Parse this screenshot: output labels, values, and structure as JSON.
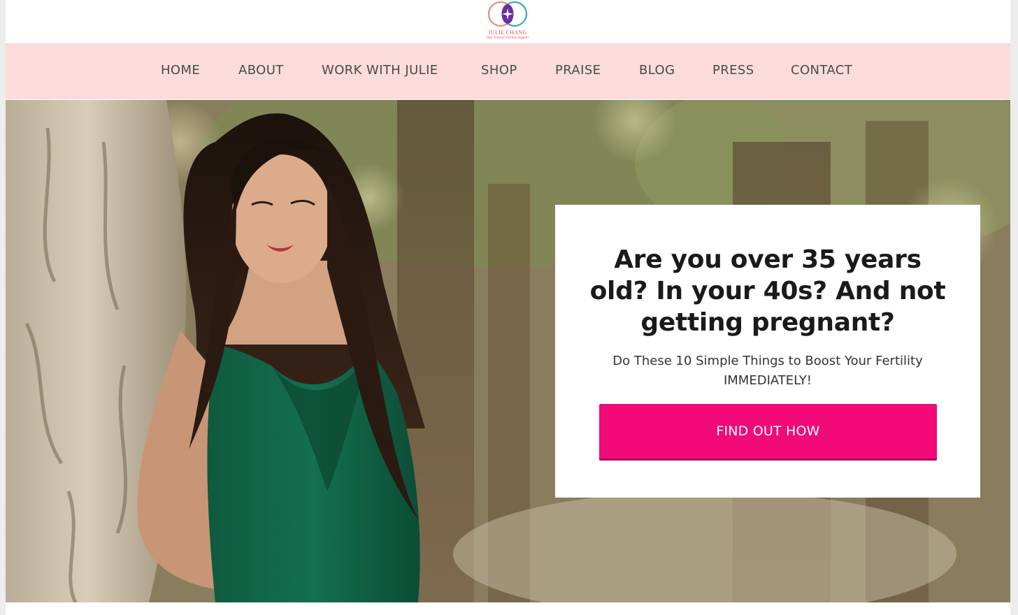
{
  "logo": {
    "name": "JULIE CHANG",
    "tagline": "Your Natural Fertility Support",
    "icon": "double-circle-star-logo-icon"
  },
  "nav": {
    "items": [
      {
        "label": "HOME"
      },
      {
        "label": "ABOUT"
      },
      {
        "label": "WORK WITH JULIE"
      },
      {
        "label": "SHOP"
      },
      {
        "label": "PRAISE"
      },
      {
        "label": "BLOG"
      },
      {
        "label": "PRESS"
      },
      {
        "label": "CONTACT"
      }
    ]
  },
  "hero": {
    "image": "woman-leaning-on-tree-photo",
    "headline": "Are you over 35 years old? In your 40s? And not getting pregnant?",
    "subtext": "Do These 10 Simple Things to Boost Your Fertility IMMEDIATELY!",
    "button_label": "FIND OUT HOW"
  },
  "colors": {
    "nav_background": "#fbdbdb",
    "nav_text": "#4a4a4a",
    "headline_text": "#1a1a1a",
    "body_text": "#333333",
    "button_background": "#f20a78",
    "button_shadow": "#b0065a",
    "button_text": "#ffffff",
    "logo_coral": "#e98b7d",
    "logo_teal": "#3aa6b9",
    "logo_purple": "#6b2fa0",
    "logo_text": "#d9534f"
  }
}
